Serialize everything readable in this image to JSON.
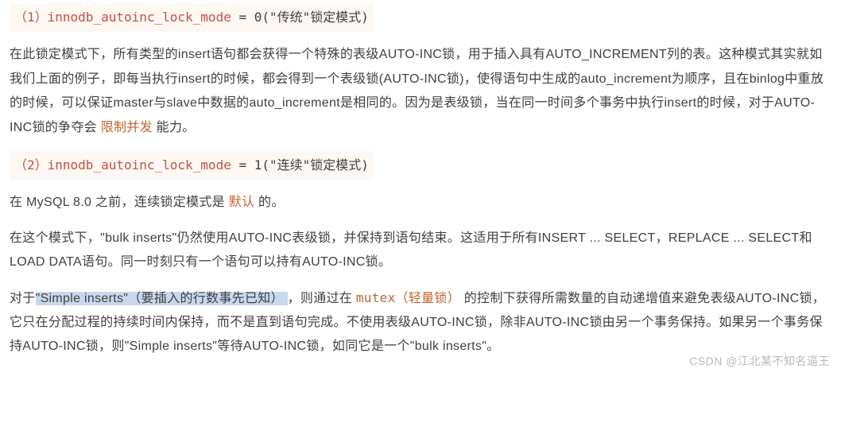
{
  "block1": {
    "label": "（1）",
    "prop": "innodb_autoinc_lock_mode",
    "value": "0",
    "desc_cn": "(\"传统\"锁定模式)"
  },
  "p1": {
    "full": "在此锁定模式下，所有类型的insert语句都会获得一个特殊的表级AUTO-INC锁，用于插入具有AUTO_INCREMENT列的表。这种模式其实就如我们上面的例子，即每当执行insert的时候，都会得到一个表级锁(AUTO-INC锁)，使得语句中生成的auto_increment为顺序，且在binlog中重放的时候，可以保证master与slave中数据的auto_increment是相同的。因为是表级锁，当在同一时间多个事务中执行insert的时候，对于AUTO-INC锁的争夺会 ",
    "highlight": "限制并发",
    "tail": " 能力。"
  },
  "block2": {
    "label": "（2）",
    "prop": "innodb_autoinc_lock_mode",
    "value": "1",
    "desc_cn": "(\"连续\"锁定模式)"
  },
  "p2": {
    "a": "在 MySQL 8.0 之前，连续锁定模式是 ",
    "highlight": "默认",
    "b": " 的。"
  },
  "p3": "在这个模式下，\"bulk inserts\"仍然使用AUTO-INC表级锁，并保持到语句结束。这适用于所有INSERT ... SELECT，REPLACE ... SELECT和LOAD DATA语句。同一时刻只有一个语句可以持有AUTO-INC锁。",
  "p4": {
    "a": "对于",
    "sel": "\"Simple inserts\"（要插入的行数事先已知） ",
    "b": "，则通过在 ",
    "mutex": "mutex（轻量锁）",
    "c": " 的控制下获得所需数量的自动递增值来避免表级AUTO-INC锁， 它只在分配过程的持续时间内保持，而不是直到语句完成。不使用表级AUTO-INC锁，除非AUTO-INC锁由另一个事务保持。如果另一个事务保持AUTO-INC锁，则\"Simple inserts\"等待AUTO-INC锁，如同它是一个\"bulk inserts\"。"
  },
  "watermark": "CSDN @江北某不知名逼王"
}
